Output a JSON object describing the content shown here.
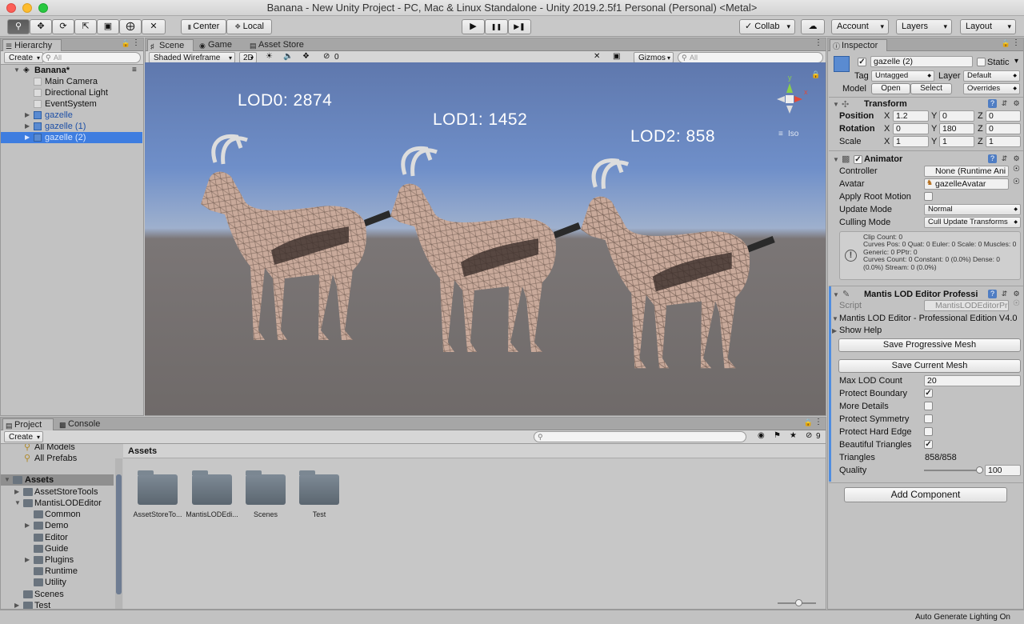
{
  "window": {
    "title": "Banana - New Unity Project - PC, Mac & Linux Standalone - Unity 2019.2.5f1 Personal (Personal) <Metal>"
  },
  "toolbar": {
    "center": "Center",
    "local": "Local",
    "collab": "Collab",
    "account": "Account",
    "layers": "Layers",
    "layout": "Layout",
    "tools": [
      "hand-icon",
      "move-icon",
      "rotate-icon",
      "scale-icon",
      "rect-icon",
      "transform-icon",
      "custom-tool-icon"
    ],
    "play_icon": "▶",
    "pause_icon": "❚❚",
    "step_icon": "▶❚"
  },
  "hierarchy": {
    "tab": "Hierarchy",
    "create": "Create",
    "search_placeholder": "All",
    "scene": "Banana*",
    "items": [
      "Main Camera",
      "Directional Light",
      "EventSystem",
      "gazelle",
      "gazelle (1)",
      "gazelle (2)"
    ]
  },
  "scene": {
    "tabs": [
      "Scene",
      "Game",
      "Asset Store"
    ],
    "shading": "Shaded Wireframe",
    "mode2d": "2D",
    "hidden_count": "0",
    "gizmos": "Gizmos",
    "search_placeholder": "All",
    "iso": "Iso",
    "labels": [
      "LOD0: 2874",
      "LOD1: 1452",
      "LOD2: 858"
    ]
  },
  "project": {
    "tabs": [
      "Project",
      "Console"
    ],
    "create": "Create",
    "path": "Assets",
    "hidden_count": "9",
    "favorites": [
      "All Models",
      "All Prefabs"
    ],
    "tree": [
      {
        "label": "Assets",
        "level": 0
      },
      {
        "label": "AssetStoreTools",
        "level": 1
      },
      {
        "label": "MantisLODEditor",
        "level": 1
      },
      {
        "label": "Common",
        "level": 2
      },
      {
        "label": "Demo",
        "level": 2
      },
      {
        "label": "Editor",
        "level": 2
      },
      {
        "label": "Guide",
        "level": 2
      },
      {
        "label": "Plugins",
        "level": 2
      },
      {
        "label": "Runtime",
        "level": 2
      },
      {
        "label": "Utility",
        "level": 2
      },
      {
        "label": "Scenes",
        "level": 1
      },
      {
        "label": "Test",
        "level": 1
      }
    ],
    "folders": [
      "AssetStoreTo...",
      "MantisLODEdi...",
      "Scenes",
      "Test"
    ]
  },
  "inspector": {
    "tab": "Inspector",
    "object_name": "gazelle (2)",
    "static": "Static",
    "tag_label": "Tag",
    "tag": "Untagged",
    "layer_label": "Layer",
    "layer": "Default",
    "model_label": "Model",
    "open": "Open",
    "select": "Select",
    "overrides": "Overrides",
    "transform": {
      "title": "Transform",
      "position": "Position",
      "rotation": "Rotation",
      "scale": "Scale",
      "x": "X",
      "y": "Y",
      "z": "Z",
      "pos": [
        "1.2",
        "0",
        "0"
      ],
      "rot": [
        "0",
        "180",
        "0"
      ],
      "scl": [
        "1",
        "1",
        "1"
      ]
    },
    "animator": {
      "title": "Animator",
      "controller_label": "Controller",
      "controller": "None (Runtime Ani",
      "avatar_label": "Avatar",
      "avatar": "gazelleAvatar",
      "apply_root": "Apply Root Motion",
      "update_label": "Update Mode",
      "update": "Normal",
      "culling_label": "Culling Mode",
      "culling": "Cull Update Transforms",
      "info": [
        "Clip Count: 0",
        "Curves Pos: 0 Quat: 0 Euler: 0 Scale: 0 Muscles: 0",
        "Generic: 0 PPtr: 0",
        "Curves Count: 0 Constant: 0 (0.0%) Dense: 0",
        "(0.0%) Stream: 0 (0.0%)"
      ]
    },
    "mantis": {
      "title": "Mantis LOD Editor Professi",
      "script_label": "Script",
      "script": "MantisLODEditorPro",
      "edition": "Mantis LOD Editor - Professional Edition V4.0",
      "help": "Show Help",
      "save_progressive": "Save Progressive Mesh",
      "save_current": "Save Current Mesh",
      "max_lod_label": "Max LOD Count",
      "max_lod": "20",
      "protect_boundary": "Protect Boundary",
      "more_details": "More Details",
      "protect_symmetry": "Protect Symmetry",
      "protect_hard_edge": "Protect Hard Edge",
      "beautiful_triangles": "Beautiful Triangles",
      "triangles_label": "Triangles",
      "triangles": "858/858",
      "quality_label": "Quality",
      "quality": "100",
      "quality_fraction": 1.0
    },
    "add_component": "Add Component"
  },
  "status": {
    "text": "Auto Generate Lighting On"
  },
  "colors": {
    "selection": "#3e7de0",
    "sky": "#6f8fc9",
    "ground": "#6f6a69"
  }
}
